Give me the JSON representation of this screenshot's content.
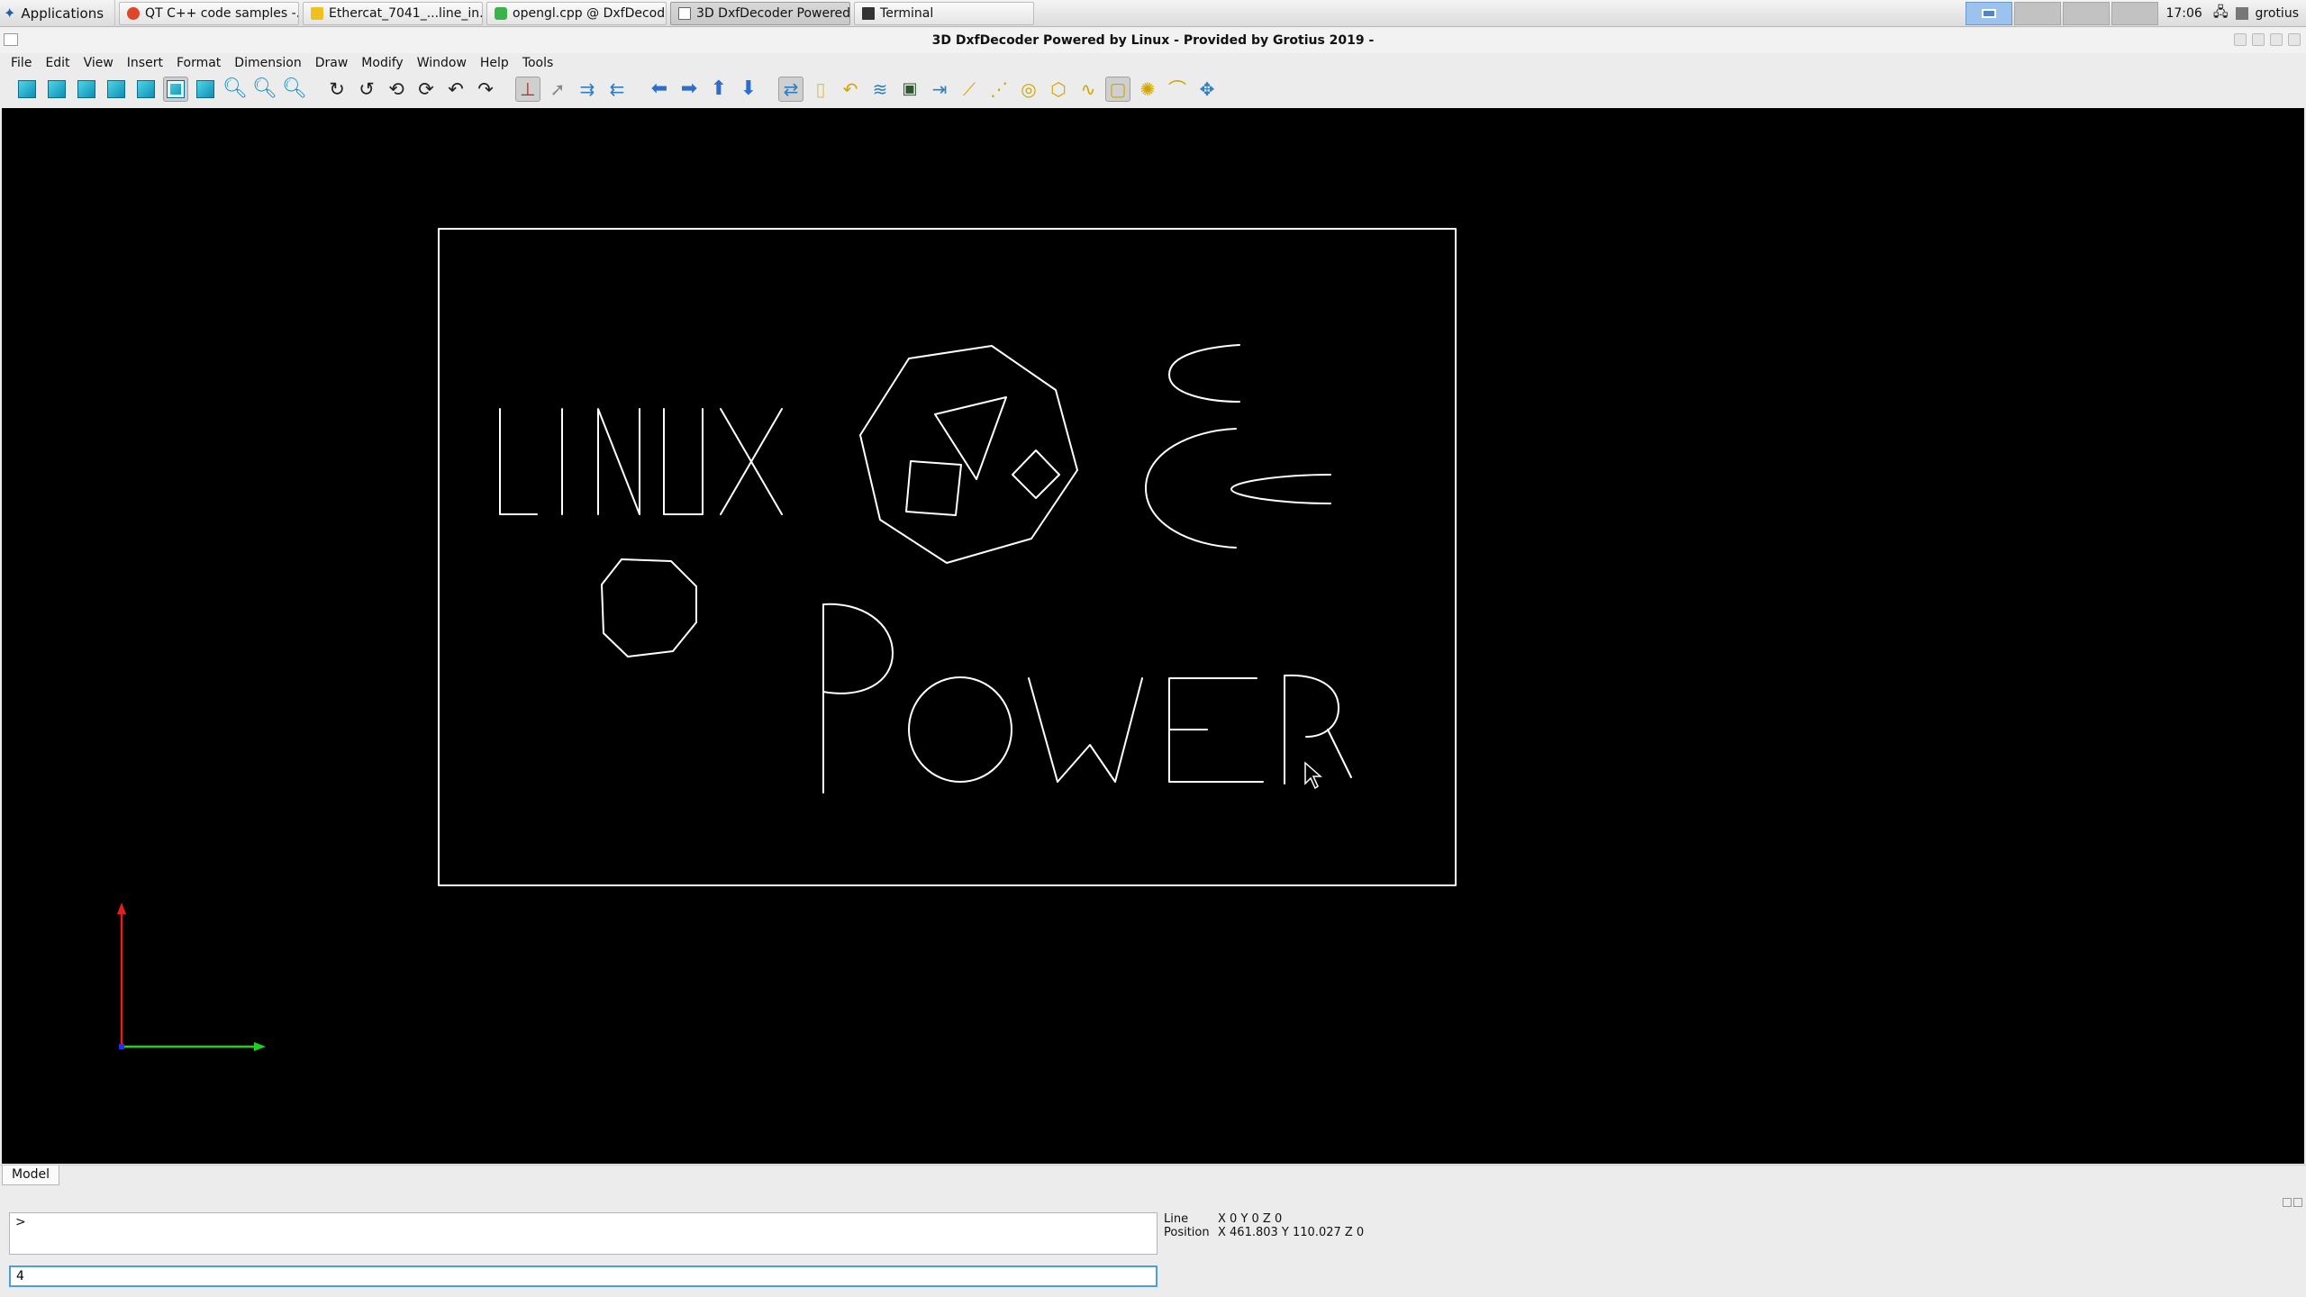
{
  "taskbar": {
    "apps_label": "Applications",
    "tasks": [
      {
        "label": "QT C++ code samples -...",
        "color": "#e0442a"
      },
      {
        "label": "Ethercat_7041_...line_in...",
        "color": "#f0c020"
      },
      {
        "label": "opengl.cpp @ DxfDecod...",
        "color": "#38b44a"
      },
      {
        "label": "3D DxfDecoder Powered...",
        "color": "#5a8fd4"
      },
      {
        "label": "Terminal",
        "color": "#333333"
      }
    ],
    "clock": "17:06",
    "user": "grotius"
  },
  "window": {
    "title": "3D DxfDecoder Powered by Linux - Provided by Grotius 2019 -"
  },
  "menu": [
    "File",
    "Edit",
    "View",
    "Insert",
    "Format",
    "Dimension",
    "Draw",
    "Modify",
    "Window",
    "Help",
    "Tools"
  ],
  "tabs": {
    "model": "Model"
  },
  "command": {
    "history": ">",
    "input_value": "4"
  },
  "status": {
    "line_label": "Line",
    "line_value": "X 0 Y 0 Z 0",
    "position_label": "Position",
    "position_value": "X 461.803 Y 110.027 Z 0"
  },
  "colors": {
    "viewport_bg": "#000000",
    "axis_y": "#e02020",
    "axis_x": "#20d020",
    "input_focus": "#4a9ee0"
  }
}
